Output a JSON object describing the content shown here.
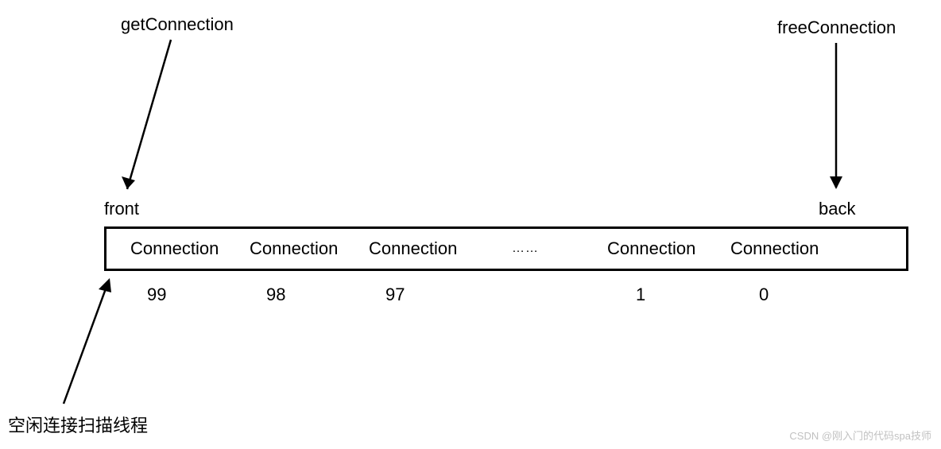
{
  "labels": {
    "get": "getConnection",
    "free": "freeConnection",
    "front": "front",
    "back": "back",
    "scanner": "空闲连接扫描线程",
    "ellipsis": "……"
  },
  "cells": {
    "c0": "Connection",
    "c1": "Connection",
    "c2": "Connection",
    "c3": "Connection",
    "c4": "Connection"
  },
  "indices": {
    "i0": "99",
    "i1": "98",
    "i2": "97",
    "i3": "1",
    "i4": "0"
  },
  "watermark": "CSDN @刚入门的代码spa技师"
}
